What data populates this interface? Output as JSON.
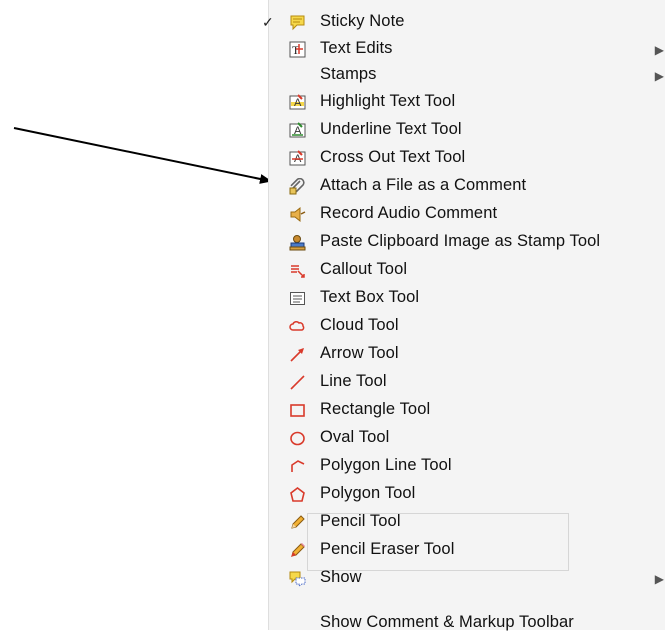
{
  "menu": {
    "items": [
      {
        "label": "Sticky Note",
        "icon": "sticky-note-icon",
        "checked": true,
        "submenu": false
      },
      {
        "label": "Text Edits",
        "icon": "text-edits-icon",
        "checked": false,
        "submenu": true
      },
      {
        "label": "Stamps",
        "icon": "",
        "checked": false,
        "submenu": true
      },
      {
        "label": "Highlight Text Tool",
        "icon": "highlight-text-icon",
        "checked": false,
        "submenu": false
      },
      {
        "label": "Underline Text Tool",
        "icon": "underline-text-icon",
        "checked": false,
        "submenu": false
      },
      {
        "label": "Cross Out Text Tool",
        "icon": "cross-out-text-icon",
        "checked": false,
        "submenu": false
      },
      {
        "label": "Attach a File as a Comment",
        "icon": "paperclip-icon",
        "checked": false,
        "submenu": false
      },
      {
        "label": "Record Audio Comment",
        "icon": "speaker-icon",
        "checked": false,
        "submenu": false
      },
      {
        "label": "Paste Clipboard Image as Stamp Tool",
        "icon": "stamp-icon",
        "checked": false,
        "submenu": false
      },
      {
        "label": "Callout Tool",
        "icon": "callout-icon",
        "checked": false,
        "submenu": false
      },
      {
        "label": "Text Box Tool",
        "icon": "text-box-icon",
        "checked": false,
        "submenu": false
      },
      {
        "label": "Cloud Tool",
        "icon": "cloud-icon",
        "checked": false,
        "submenu": false
      },
      {
        "label": "Arrow Tool",
        "icon": "arrow-icon",
        "checked": false,
        "submenu": false
      },
      {
        "label": "Line Tool",
        "icon": "line-icon",
        "checked": false,
        "submenu": false
      },
      {
        "label": "Rectangle Tool",
        "icon": "rectangle-icon",
        "checked": false,
        "submenu": false
      },
      {
        "label": "Oval Tool",
        "icon": "oval-icon",
        "checked": false,
        "submenu": false
      },
      {
        "label": "Polygon Line Tool",
        "icon": "polygon-line-icon",
        "checked": false,
        "submenu": false
      },
      {
        "label": "Polygon Tool",
        "icon": "polygon-icon",
        "checked": false,
        "submenu": false
      },
      {
        "label": "Pencil Tool",
        "icon": "pencil-icon",
        "checked": false,
        "submenu": false
      },
      {
        "label": "Pencil Eraser Tool",
        "icon": "pencil-eraser-icon",
        "checked": false,
        "submenu": false
      },
      {
        "label": "Show",
        "icon": "show-comments-icon",
        "checked": false,
        "submenu": true
      },
      {
        "label": "Show Comment & Markup Toolbar",
        "icon": "",
        "checked": false,
        "submenu": false
      }
    ],
    "checkmark": "✓",
    "submenu_arrow": "▶"
  },
  "colors": {
    "menu_bg": "#f4f4f4",
    "markup_red": "#d93a2b",
    "sticky_yellow": "#f6d84a",
    "arrow": "#000000"
  }
}
